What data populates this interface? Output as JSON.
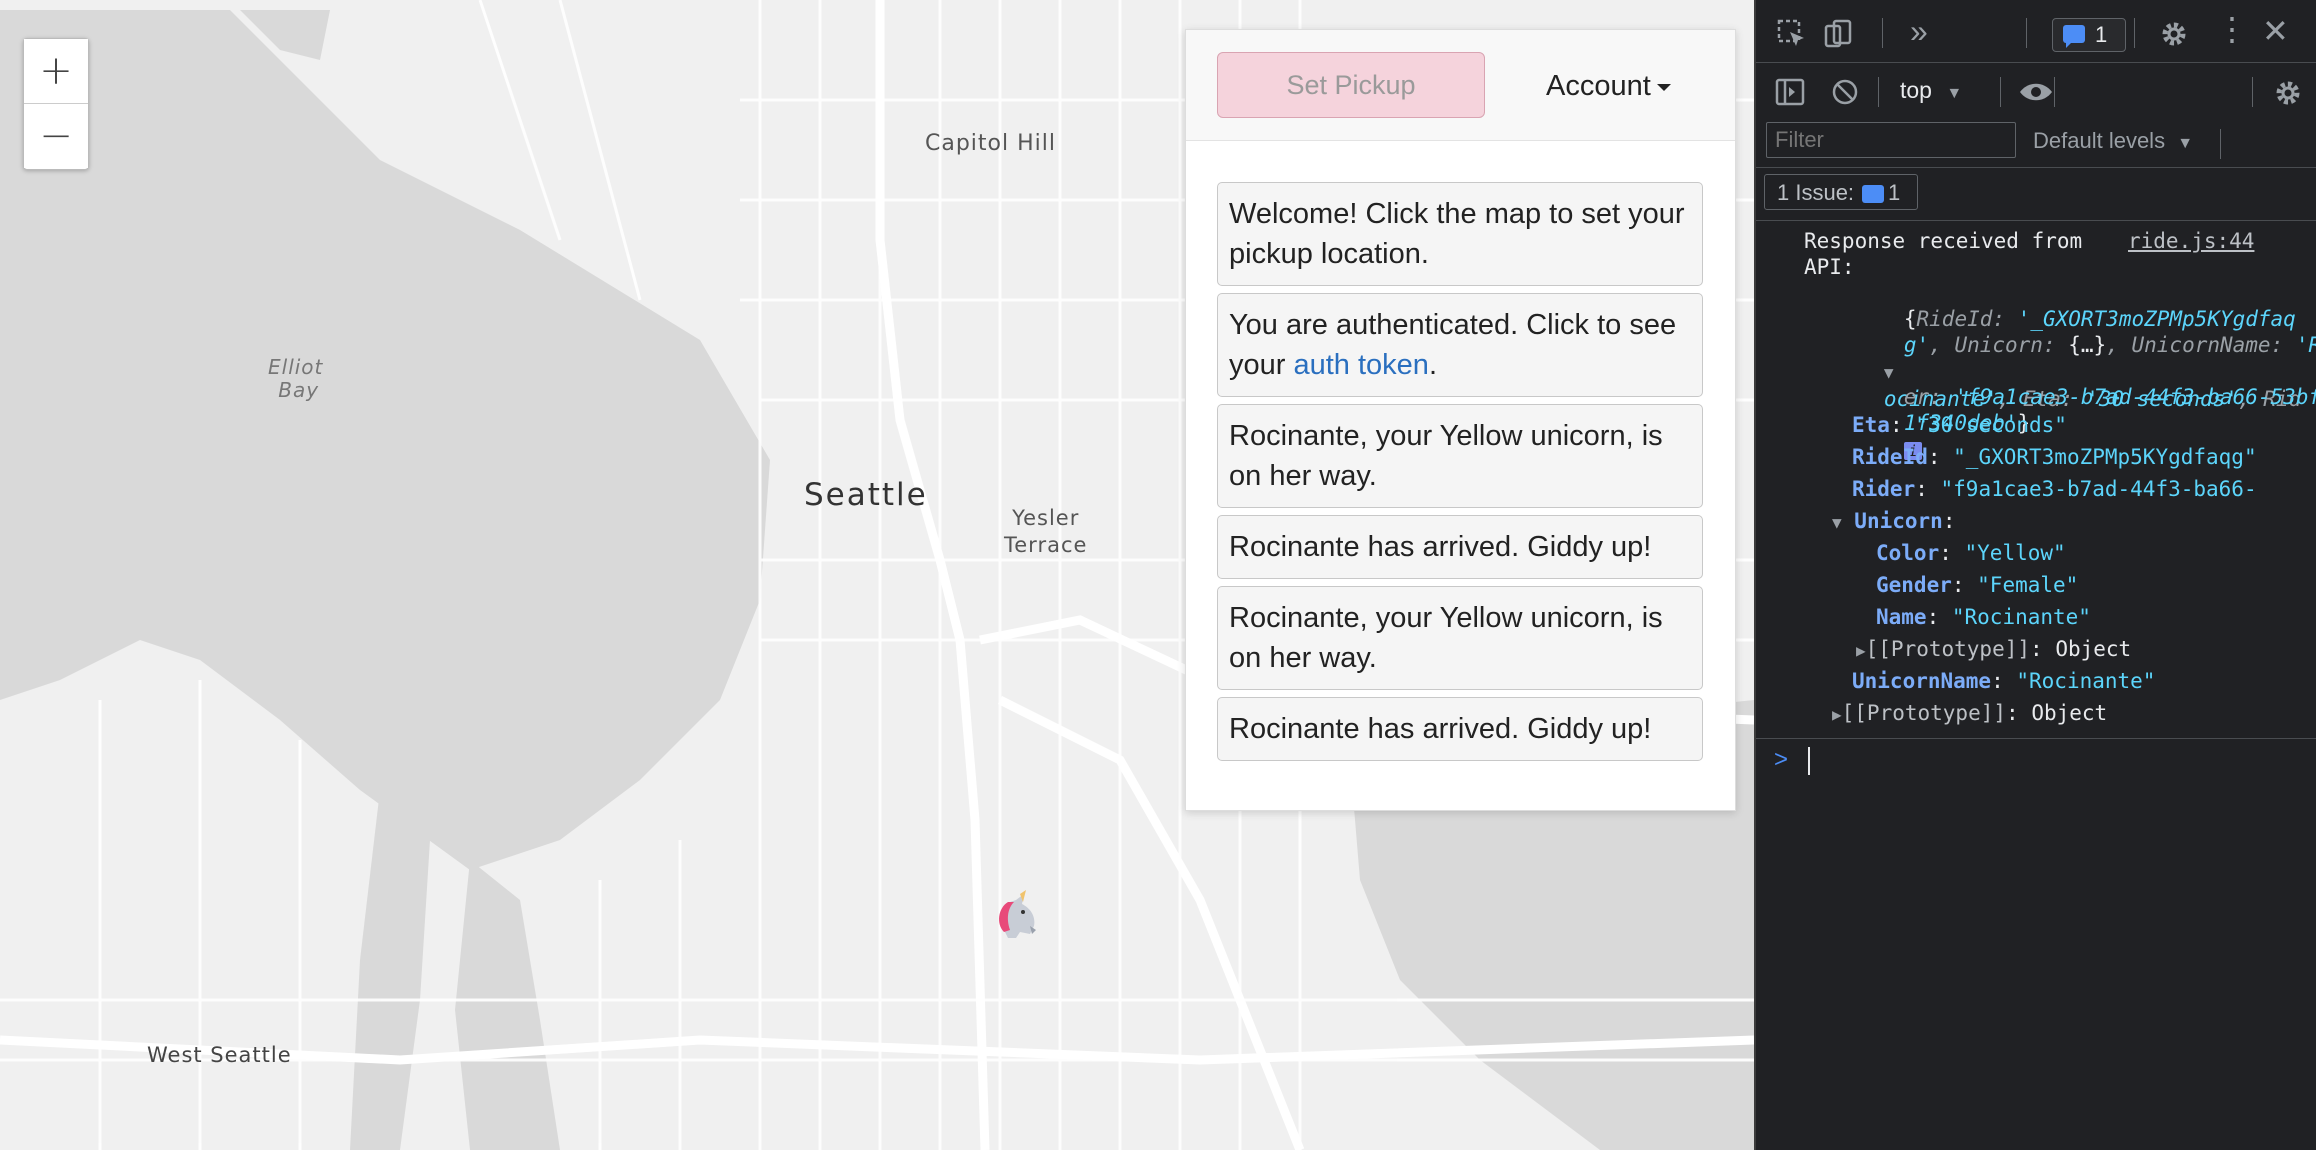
{
  "map": {
    "labels": {
      "capitol_hill": "Capitol Hill",
      "elliot_bay_1": "Elliot",
      "elliot_bay_2": "Bay",
      "seattle": "Seattle",
      "yesler_1": "Yesler",
      "yesler_2": "Terrace",
      "west_seattle": "West Seattle"
    },
    "zoom_in": "+",
    "zoom_out": "−",
    "marker_icon": "unicorn-icon"
  },
  "panel": {
    "set_pickup_label": "Set Pickup",
    "account_label": "Account",
    "messages": [
      {
        "text": "Welcome! Click the map to set your pickup location."
      },
      {
        "text_before": "You are authenticated. Click to see your ",
        "link": "auth token",
        "text_after": "."
      },
      {
        "text": "Rocinante, your Yellow unicorn, is on her way."
      },
      {
        "text": "Rocinante has arrived. Giddy up!"
      },
      {
        "text": "Rocinante, your Yellow unicorn, is on her way."
      },
      {
        "text": "Rocinante has arrived. Giddy up!"
      }
    ]
  },
  "devtools": {
    "toolbar": {
      "issues_badge_count": "1",
      "context": "top",
      "filter_placeholder": "Filter",
      "levels": "Default levels",
      "issues_label": "1 Issue:",
      "issues_count": "1"
    },
    "console": {
      "message_1": "Response received from",
      "message_2": "API:",
      "source": "ride.js:44",
      "preview": {
        "l1_a": "{",
        "l1_k": "RideId",
        "l1_v": "'_GXORT3moZPMp5KYgdfaq",
        "l2_v": "g'",
        "l2_k": "Unicorn",
        "l2_m": "{…}",
        "l2_k2": "UnicornName",
        "l2_v2": "'R",
        "l3_v": "ocinante'",
        "l3_k": "Eta",
        "l3_v2": "'30 seconds'",
        "l3_k2": "Rid",
        "l4_k": "er",
        "l4_v": "'f9a1cae3-b7ad-44f3-ba66-53bf",
        "l5_v": "1f340deb'",
        "l5_b": "}"
      },
      "props": {
        "eta_key": "Eta",
        "eta_val": "\"30 seconds\"",
        "rideid_key": "RideId",
        "rideid_val": "\"_GXORT3moZPMp5KYgdfaqg\"",
        "rider_key": "Rider",
        "rider_val": "\"f9a1cae3-b7ad-44f3-ba66-",
        "unicorn_key": "Unicorn",
        "color_key": "Color",
        "color_val": "\"Yellow\"",
        "gender_key": "Gender",
        "gender_val": "\"Female\"",
        "name_key": "Name",
        "name_val": "\"Rocinante\"",
        "proto_key": "[[Prototype]]",
        "proto_val": "Object",
        "uname_key": "UnicornName",
        "uname_val": "\"Rocinante\"",
        "proto2_key": "[[Prototype]]",
        "proto2_val": "Object"
      },
      "prompt": ">"
    }
  }
}
